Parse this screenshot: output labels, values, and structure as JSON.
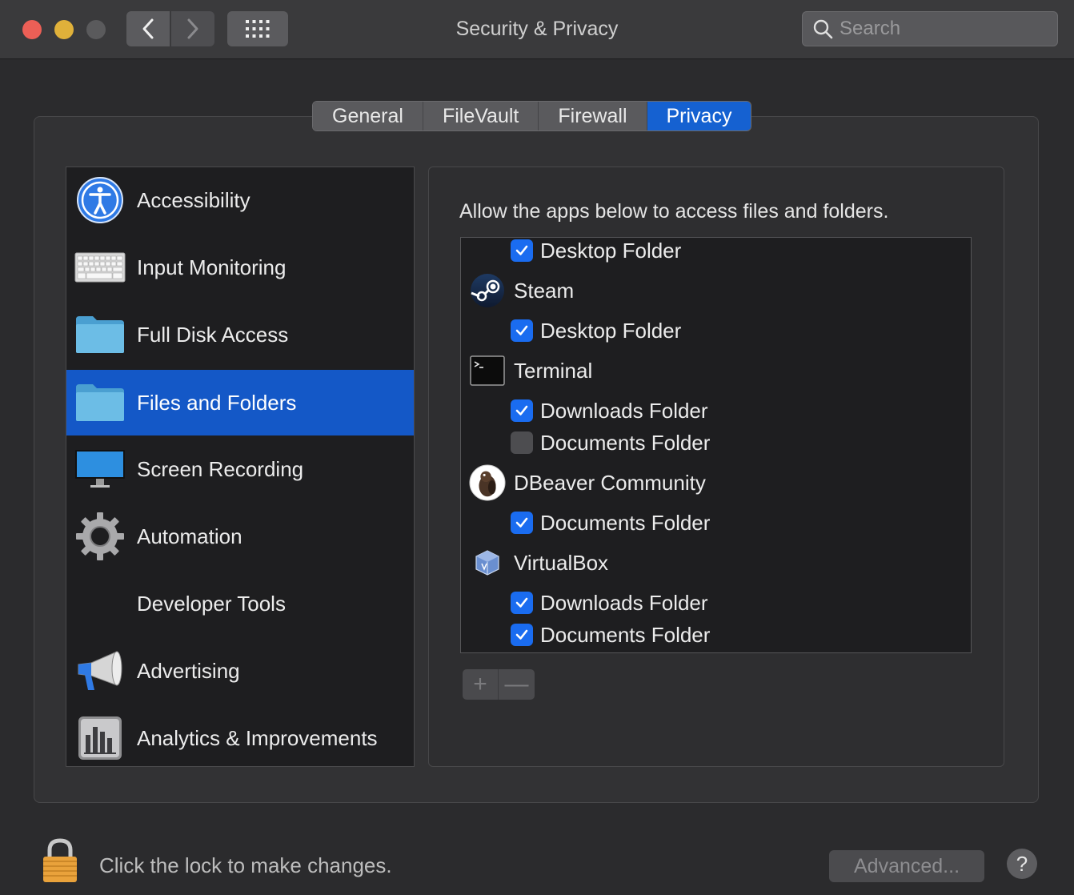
{
  "window": {
    "title": "Security & Privacy",
    "search_placeholder": "Search"
  },
  "tabs": [
    {
      "label": "General"
    },
    {
      "label": "FileVault"
    },
    {
      "label": "Firewall"
    },
    {
      "label": "Privacy",
      "active": true
    }
  ],
  "sidebar": {
    "items": [
      {
        "label": "Accessibility",
        "icon": "accessibility-icon"
      },
      {
        "label": "Input Monitoring",
        "icon": "keyboard-icon"
      },
      {
        "label": "Full Disk Access",
        "icon": "folder-icon"
      },
      {
        "label": "Files and Folders",
        "icon": "folder-icon",
        "selected": true
      },
      {
        "label": "Screen Recording",
        "icon": "display-icon"
      },
      {
        "label": "Automation",
        "icon": "gear-icon"
      },
      {
        "label": "Developer Tools",
        "icon": ""
      },
      {
        "label": "Advertising",
        "icon": "megaphone-icon"
      },
      {
        "label": "Analytics & Improvements",
        "icon": "analytics-icon"
      }
    ]
  },
  "panel": {
    "description": "Allow the apps below to access files and folders.",
    "rows": [
      {
        "type": "folder",
        "label": "Desktop Folder",
        "checked": true
      },
      {
        "type": "app",
        "label": "Steam",
        "icon": "steam-icon"
      },
      {
        "type": "folder",
        "label": "Desktop Folder",
        "checked": true
      },
      {
        "type": "app",
        "label": "Terminal",
        "icon": "terminal-icon"
      },
      {
        "type": "folder",
        "label": "Downloads Folder",
        "checked": true
      },
      {
        "type": "folder",
        "label": "Documents Folder",
        "checked": false
      },
      {
        "type": "app",
        "label": "DBeaver Community",
        "icon": "dbeaver-icon"
      },
      {
        "type": "folder",
        "label": "Documents Folder",
        "checked": true
      },
      {
        "type": "app",
        "label": "VirtualBox",
        "icon": "virtualbox-icon"
      },
      {
        "type": "folder",
        "label": "Downloads Folder",
        "checked": true
      },
      {
        "type": "folder",
        "label": "Documents Folder",
        "checked": true
      }
    ],
    "add_label": "+",
    "remove_label": "—"
  },
  "footer": {
    "lock_text": "Click the lock to make changes.",
    "advanced_label": "Advanced...",
    "help_label": "?"
  },
  "colors": {
    "accent": "#1561d1",
    "checkbox_on": "#1a6cf0",
    "close": "#ec5f56",
    "minimize": "#e0b13a"
  }
}
